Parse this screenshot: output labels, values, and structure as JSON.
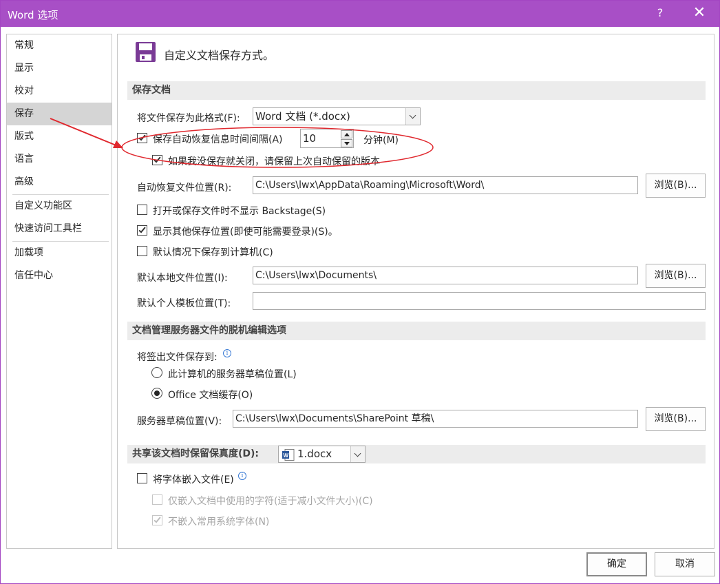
{
  "window": {
    "title": "Word 选项",
    "help_label": "?",
    "close_label": "✕"
  },
  "sidebar": {
    "items": [
      {
        "label": "常规"
      },
      {
        "label": "显示"
      },
      {
        "label": "校对"
      },
      {
        "label": "保存"
      },
      {
        "label": "版式"
      },
      {
        "label": "语言"
      },
      {
        "label": "高级"
      },
      {
        "label": "自定义功能区"
      },
      {
        "label": "快速访问工具栏"
      },
      {
        "label": "加载项"
      },
      {
        "label": "信任中心"
      }
    ],
    "selected": "保存"
  },
  "main": {
    "header_title": "自定义文档保存方式。",
    "header_icon": "floppy-disk-icon",
    "section_save": {
      "heading": "保存文档",
      "format_label": "将文件保存为此格式(F):",
      "format_value": "Word 文档 (*.docx)",
      "autorecover_label": "保存自动恢复信息时间间隔(A)",
      "autorecover_checked": true,
      "autorecover_minutes": "10",
      "minutes_unit": "分钟(M)",
      "keep_last_label": "如果我没保存就关闭，请保留上次自动保留的版本",
      "keep_last_checked": true,
      "autorecover_location_label": "自动恢复文件位置(R):",
      "autorecover_location_value": "C:\\Users\\lwx\\AppData\\Roaming\\Microsoft\\Word\\",
      "browse_label": "浏览(B)...",
      "no_backstage_label": "打开或保存文件时不显示 Backstage(S)",
      "no_backstage_checked": false,
      "show_other_label": "显示其他保存位置(即使可能需要登录)(S)。",
      "show_other_checked": true,
      "save_to_computer_label": "默认情况下保存到计算机(C)",
      "save_to_computer_checked": false,
      "local_location_label": "默认本地文件位置(I):",
      "local_location_value": "C:\\Users\\lwx\\Documents\\",
      "template_location_label": "默认个人模板位置(T):",
      "template_location_value": ""
    },
    "section_offline": {
      "heading": "文档管理服务器文件的脱机编辑选项",
      "checkout_label": "将签出文件保存到:",
      "option_server": "此计算机的服务器草稿位置(L)",
      "option_cache": "Office 文档缓存(O)",
      "selected_option": "Office 文档缓存(O)",
      "drafts_label": "服务器草稿位置(V):",
      "drafts_value": "C:\\Users\\lwx\\Documents\\SharePoint 草稿\\"
    },
    "section_fidelity": {
      "heading": "共享该文档时保留保真度(D):",
      "document_value": "1.docx",
      "embed_fonts_label": "将字体嵌入文件(E)",
      "embed_fonts_checked": false,
      "embed_used_only_label": "仅嵌入文档中使用的字符(适于减小文件大小)(C)",
      "embed_used_only_checked": false,
      "no_common_fonts_label": "不嵌入常用系统字体(N)",
      "no_common_fonts_checked": true
    }
  },
  "footer": {
    "ok_label": "确定",
    "cancel_label": "取消"
  },
  "colors": {
    "titlebar": "#a84fc6",
    "selected_nav": "#d5d5d5",
    "annotation": "#e0282e"
  }
}
